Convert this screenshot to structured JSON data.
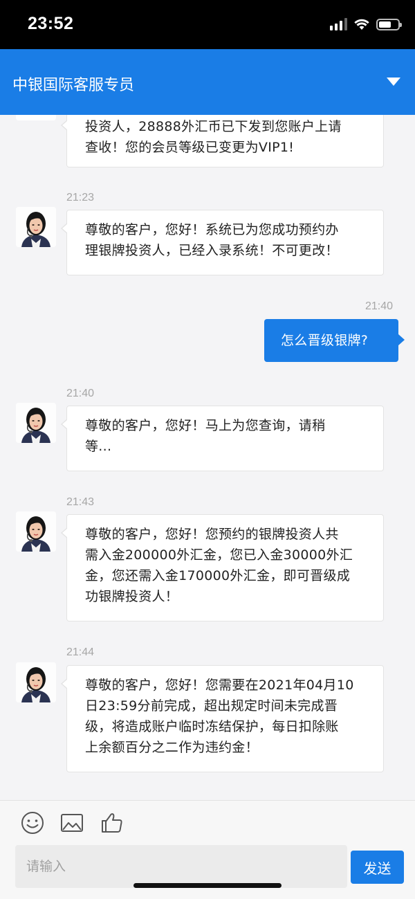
{
  "status_bar": {
    "time": "23:52",
    "icons": [
      "signal-icon",
      "wifi-icon",
      "battery-icon"
    ]
  },
  "header": {
    "title": "中银国际客服专员",
    "toggle_icon": "chevron-down-icon"
  },
  "messages": [
    {
      "side": "left",
      "time": "",
      "lines": [
        "投资人，28888外汇币已下发到您账户上请",
        "查收！您的会员等级已变更为VIP1!"
      ]
    },
    {
      "side": "left",
      "time": "21:23",
      "lines": [
        "尊敬的客户，您好！系统已为您成功预约办",
        "理银牌投资人，已经入录系统！不可更改！"
      ]
    },
    {
      "side": "right",
      "time": "21:40",
      "lines": [
        "怎么晋级银牌?"
      ]
    },
    {
      "side": "left",
      "time": "21:40",
      "lines": [
        "尊敬的客户，您好！马上为您查询，请稍",
        "等..."
      ]
    },
    {
      "side": "left",
      "time": "21:43",
      "lines": [
        "尊敬的客户，您好！您预约的银牌投资人共",
        "需入金200000外汇金，您已入金30000外汇",
        "金，您还需入金170000外汇金，即可晋级成",
        "功银牌投资人！"
      ]
    },
    {
      "side": "left",
      "time": "21:44",
      "lines": [
        "尊敬的客户，您好！您需要在2021年04月10",
        "日23:59分前完成，超出规定时间未完成晋",
        "级，将造成账户临时冻结保护，每日扣除账",
        "上余额百分之二作为违约金！"
      ]
    }
  ],
  "toolbar": {
    "icons": [
      "emoji-icon",
      "image-icon",
      "thumbs-up-icon"
    ],
    "input_placeholder": "请输入",
    "input_value": "",
    "send_label": "发送"
  },
  "colors": {
    "accent": "#1a7de6",
    "background": "#f4f4f6",
    "bubble": "#ffffff",
    "timestamp": "#a6a6a6"
  }
}
